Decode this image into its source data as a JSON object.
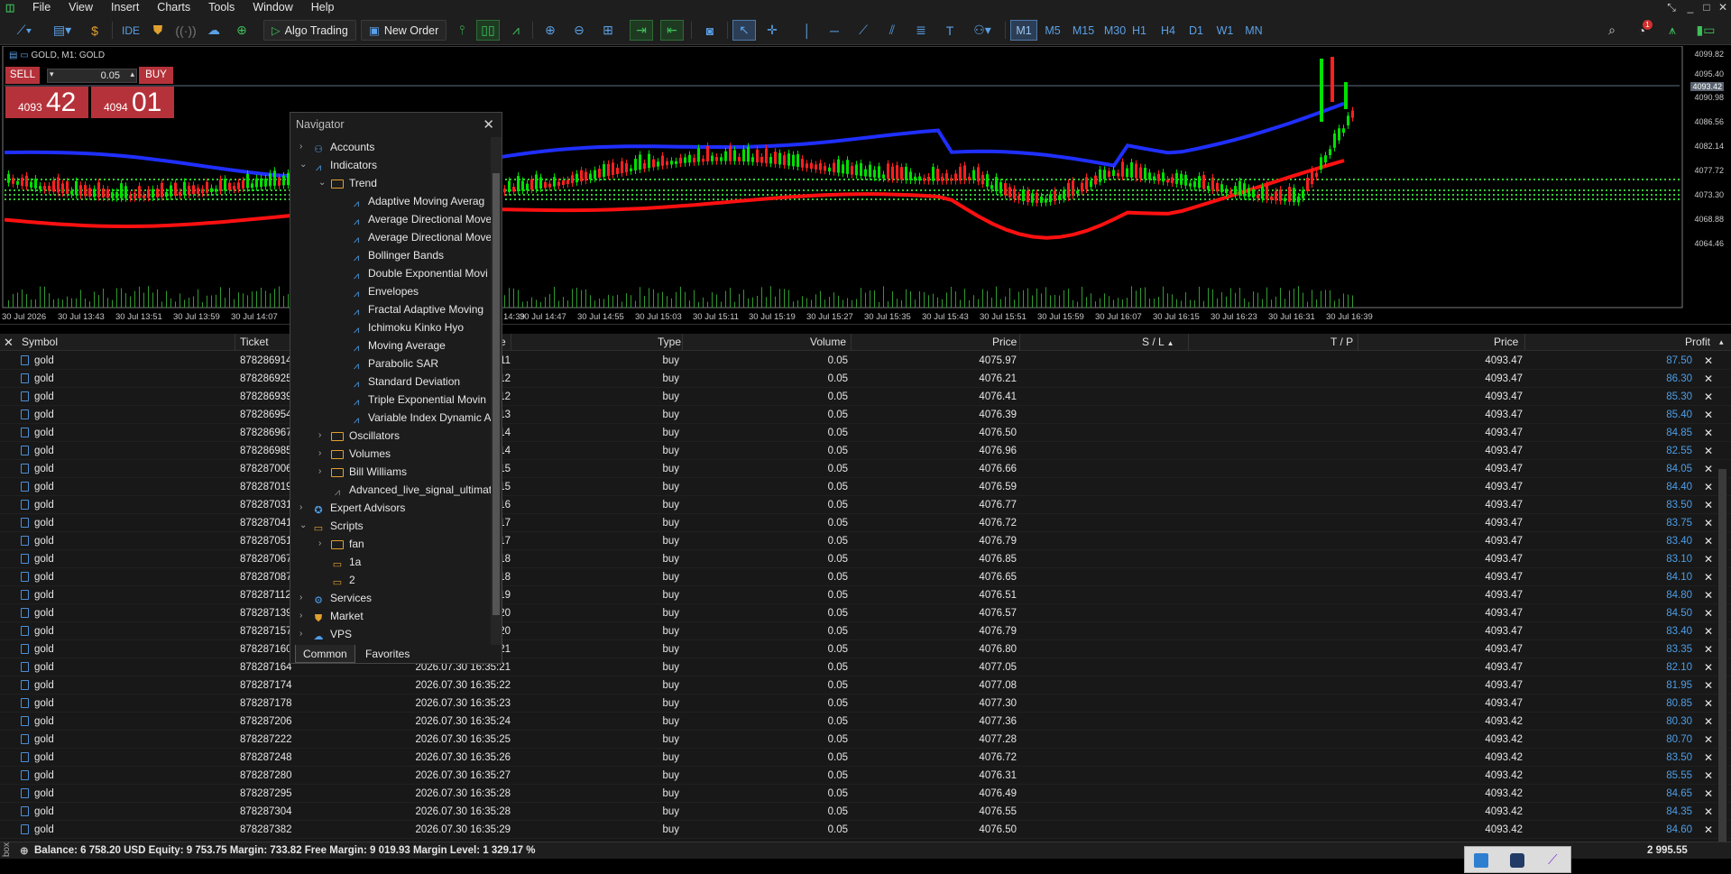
{
  "menu": [
    "File",
    "View",
    "Insert",
    "Charts",
    "Tools",
    "Window",
    "Help"
  ],
  "toolbar": {
    "algo_trading": "Algo Trading",
    "new_order": "New Order",
    "ide": "IDE",
    "timeframes": [
      "M1",
      "M5",
      "M15",
      "M30",
      "H1",
      "H4",
      "D1",
      "W1",
      "MN"
    ],
    "active_timeframe": "M1",
    "notification_count": "1"
  },
  "chart": {
    "label": "GOLD, M1: GOLD",
    "sell_label": "SELL",
    "buy_label": "BUY",
    "lot": "0.05",
    "sell_small": "4093",
    "sell_big": "42",
    "buy_small": "4094",
    "buy_big": "01",
    "y_ticks": [
      "4099.82",
      "4095.40",
      "4093.42",
      "4090.98",
      "4086.56",
      "4082.14",
      "4077.72",
      "4073.30",
      "4068.88",
      "4064.46"
    ],
    "x_ticks": [
      "30 Jul 2026",
      "30 Jul 13:43",
      "30 Jul 13:51",
      "30 Jul 13:59",
      "30 Jul 14:07",
      "30 Jul 14:39",
      "30 Jul 14:47",
      "30 Jul 14:55",
      "30 Jul 15:03",
      "30 Jul 15:11",
      "30 Jul 15:19",
      "30 Jul 15:27",
      "30 Jul 15:35",
      "30 Jul 15:43",
      "30 Jul 15:51",
      "30 Jul 15:59",
      "30 Jul 16:07",
      "30 Jul 16:15",
      "30 Jul 16:23",
      "30 Jul 16:31",
      "30 Jul 16:39"
    ],
    "colors": {
      "up": "#00e000",
      "down": "#ff2020",
      "upper_band": "#1f2fff",
      "lower_band": "#ff1010",
      "grid": "#33cc33"
    }
  },
  "navigator": {
    "title": "Navigator",
    "accounts": "Accounts",
    "indicators": "Indicators",
    "trend": "Trend",
    "trend_items": [
      "Adaptive Moving Averag",
      "Average Directional Move",
      "Average Directional Move",
      "Bollinger Bands",
      "Double Exponential Movi",
      "Envelopes",
      "Fractal Adaptive Moving",
      "Ichimoku Kinko Hyo",
      "Moving Average",
      "Parabolic SAR",
      "Standard Deviation",
      "Triple Exponential Movin",
      "Variable Index Dynamic A"
    ],
    "oscillators": "Oscillators",
    "volumes": "Volumes",
    "bill_williams": "Bill Williams",
    "custom_indicator": "Advanced_live_signal_ultimat",
    "expert_advisors": "Expert Advisors",
    "scripts": "Scripts",
    "script_items": [
      "fan",
      "1a",
      "2"
    ],
    "services": "Services",
    "market": "Market",
    "vps": "VPS",
    "tabs": [
      "Common",
      "Favorites"
    ]
  },
  "table": {
    "headers": {
      "symbol": "Symbol",
      "ticket": "Ticket",
      "time": "e",
      "type": "Type",
      "volume": "Volume",
      "price": "Price",
      "sl": "S / L",
      "tp": "T / P",
      "cur_price": "Price",
      "profit": "Profit"
    },
    "rows": [
      {
        "symbol": "gold",
        "ticket": "878286914",
        "time": "11",
        "type": "buy",
        "volume": "0.05",
        "price": "4075.97",
        "cur": "4093.47",
        "profit": "87.50"
      },
      {
        "symbol": "gold",
        "ticket": "878286925",
        "time": "12",
        "type": "buy",
        "volume": "0.05",
        "price": "4076.21",
        "cur": "4093.47",
        "profit": "86.30"
      },
      {
        "symbol": "gold",
        "ticket": "878286939",
        "time": "12",
        "type": "buy",
        "volume": "0.05",
        "price": "4076.41",
        "cur": "4093.47",
        "profit": "85.30"
      },
      {
        "symbol": "gold",
        "ticket": "878286954",
        "time": "13",
        "type": "buy",
        "volume": "0.05",
        "price": "4076.39",
        "cur": "4093.47",
        "profit": "85.40"
      },
      {
        "symbol": "gold",
        "ticket": "878286967",
        "time": "14",
        "type": "buy",
        "volume": "0.05",
        "price": "4076.50",
        "cur": "4093.47",
        "profit": "84.85"
      },
      {
        "symbol": "gold",
        "ticket": "878286985",
        "time": "14",
        "type": "buy",
        "volume": "0.05",
        "price": "4076.96",
        "cur": "4093.47",
        "profit": "82.55"
      },
      {
        "symbol": "gold",
        "ticket": "878287006",
        "time": "15",
        "type": "buy",
        "volume": "0.05",
        "price": "4076.66",
        "cur": "4093.47",
        "profit": "84.05"
      },
      {
        "symbol": "gold",
        "ticket": "878287019",
        "time": "15",
        "type": "buy",
        "volume": "0.05",
        "price": "4076.59",
        "cur": "4093.47",
        "profit": "84.40"
      },
      {
        "symbol": "gold",
        "ticket": "878287031",
        "time": "16",
        "type": "buy",
        "volume": "0.05",
        "price": "4076.77",
        "cur": "4093.47",
        "profit": "83.50"
      },
      {
        "symbol": "gold",
        "ticket": "878287041",
        "time": "17",
        "type": "buy",
        "volume": "0.05",
        "price": "4076.72",
        "cur": "4093.47",
        "profit": "83.75"
      },
      {
        "symbol": "gold",
        "ticket": "878287051",
        "time": "17",
        "type": "buy",
        "volume": "0.05",
        "price": "4076.79",
        "cur": "4093.47",
        "profit": "83.40"
      },
      {
        "symbol": "gold",
        "ticket": "878287067",
        "time": "18",
        "type": "buy",
        "volume": "0.05",
        "price": "4076.85",
        "cur": "4093.47",
        "profit": "83.10"
      },
      {
        "symbol": "gold",
        "ticket": "878287087",
        "time": "18",
        "type": "buy",
        "volume": "0.05",
        "price": "4076.65",
        "cur": "4093.47",
        "profit": "84.10"
      },
      {
        "symbol": "gold",
        "ticket": "878287112",
        "time": "19",
        "type": "buy",
        "volume": "0.05",
        "price": "4076.51",
        "cur": "4093.47",
        "profit": "84.80"
      },
      {
        "symbol": "gold",
        "ticket": "878287139",
        "time": "20",
        "type": "buy",
        "volume": "0.05",
        "price": "4076.57",
        "cur": "4093.47",
        "profit": "84.50"
      },
      {
        "symbol": "gold",
        "ticket": "878287157",
        "time": "20",
        "type": "buy",
        "volume": "0.05",
        "price": "4076.79",
        "cur": "4093.47",
        "profit": "83.40"
      },
      {
        "symbol": "gold",
        "ticket": "878287160",
        "time": "21",
        "type": "buy",
        "volume": "0.05",
        "price": "4076.80",
        "cur": "4093.47",
        "profit": "83.35"
      },
      {
        "symbol": "gold",
        "ticket": "878287164",
        "time": "2026.07.30 16:35:21",
        "type": "buy",
        "volume": "0.05",
        "price": "4077.05",
        "cur": "4093.47",
        "profit": "82.10"
      },
      {
        "symbol": "gold",
        "ticket": "878287174",
        "time": "2026.07.30 16:35:22",
        "type": "buy",
        "volume": "0.05",
        "price": "4077.08",
        "cur": "4093.47",
        "profit": "81.95"
      },
      {
        "symbol": "gold",
        "ticket": "878287178",
        "time": "2026.07.30 16:35:23",
        "type": "buy",
        "volume": "0.05",
        "price": "4077.30",
        "cur": "4093.47",
        "profit": "80.85"
      },
      {
        "symbol": "gold",
        "ticket": "878287206",
        "time": "2026.07.30 16:35:24",
        "type": "buy",
        "volume": "0.05",
        "price": "4077.36",
        "cur": "4093.42",
        "profit": "80.30"
      },
      {
        "symbol": "gold",
        "ticket": "878287222",
        "time": "2026.07.30 16:35:25",
        "type": "buy",
        "volume": "0.05",
        "price": "4077.28",
        "cur": "4093.42",
        "profit": "80.70"
      },
      {
        "symbol": "gold",
        "ticket": "878287248",
        "time": "2026.07.30 16:35:26",
        "type": "buy",
        "volume": "0.05",
        "price": "4076.72",
        "cur": "4093.42",
        "profit": "83.50"
      },
      {
        "symbol": "gold",
        "ticket": "878287280",
        "time": "2026.07.30 16:35:27",
        "type": "buy",
        "volume": "0.05",
        "price": "4076.31",
        "cur": "4093.42",
        "profit": "85.55"
      },
      {
        "symbol": "gold",
        "ticket": "878287295",
        "time": "2026.07.30 16:35:28",
        "type": "buy",
        "volume": "0.05",
        "price": "4076.49",
        "cur": "4093.42",
        "profit": "84.65"
      },
      {
        "symbol": "gold",
        "ticket": "878287304",
        "time": "2026.07.30 16:35:28",
        "type": "buy",
        "volume": "0.05",
        "price": "4076.55",
        "cur": "4093.42",
        "profit": "84.35"
      },
      {
        "symbol": "gold",
        "ticket": "878287382",
        "time": "2026.07.30 16:35:29",
        "type": "buy",
        "volume": "0.05",
        "price": "4076.50",
        "cur": "4093.42",
        "profit": "84.60"
      }
    ]
  },
  "status": {
    "balance_line": "Balance: 6 758.20 USD  Equity: 9 753.75  Margin: 733.82  Free Margin: 9 019.93  Margin Level: 1 329.17 %",
    "total_profit": "2 995.55",
    "side_label": "box"
  }
}
